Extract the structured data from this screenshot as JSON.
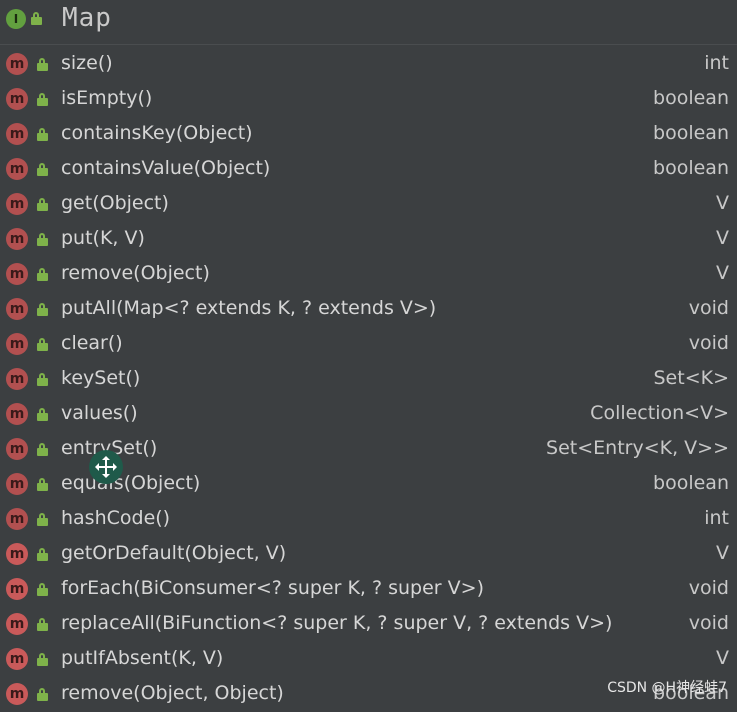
{
  "header": {
    "interface_badge": "I",
    "title": "Map"
  },
  "methods": [
    {
      "name": "size()",
      "type": "int"
    },
    {
      "name": "isEmpty()",
      "type": "boolean"
    },
    {
      "name": "containsKey(Object)",
      "type": "boolean"
    },
    {
      "name": "containsValue(Object)",
      "type": "boolean"
    },
    {
      "name": "get(Object)",
      "type": "V"
    },
    {
      "name": "put(K, V)",
      "type": "V"
    },
    {
      "name": "remove(Object)",
      "type": "V"
    },
    {
      "name": "putAll(Map<? extends K, ? extends V>)",
      "type": "void"
    },
    {
      "name": "clear()",
      "type": "void"
    },
    {
      "name": "keySet()",
      "type": "Set<K>"
    },
    {
      "name": "values()",
      "type": "Collection<V>"
    },
    {
      "name": "entrySet()",
      "type": "Set<Entry<K, V>>"
    },
    {
      "name": "equals(Object)",
      "type": "boolean"
    },
    {
      "name": "hashCode()",
      "type": "int"
    },
    {
      "name": "getOrDefault(Object, V)",
      "type": "V"
    },
    {
      "name": "forEach(BiConsumer<? super K, ? super V>)",
      "type": "void"
    },
    {
      "name": "replaceAll(BiFunction<? super K, ? super V, ? extends V>)",
      "type": "void"
    },
    {
      "name": "putIfAbsent(K, V)",
      "type": "V"
    },
    {
      "name": "remove(Object, Object)",
      "type": "boolean"
    }
  ],
  "method_badge": "m",
  "watermark": "CSDN @H神经蛙7",
  "colors": {
    "background": "#3c3f41",
    "method_badge": "#c95a5a",
    "lock": "#7fb24a",
    "interface_badge": "#62a03f"
  }
}
